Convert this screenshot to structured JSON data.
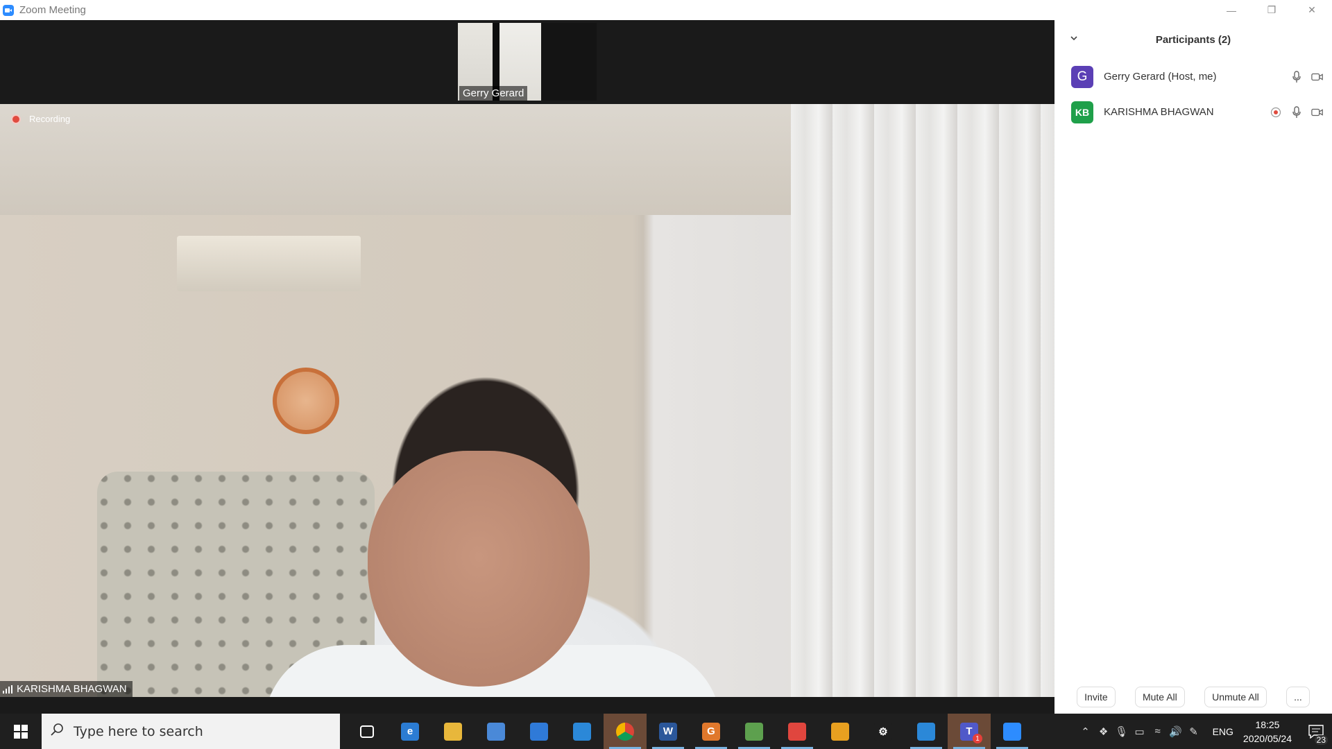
{
  "window": {
    "title": "Zoom Meeting"
  },
  "video": {
    "thumbnail_name": "Gerry Gerard",
    "recording_label": "Recording",
    "speaker_name": "KARISHMA BHAGWAN"
  },
  "participants_panel": {
    "title": "Participants (2)",
    "participants": [
      {
        "initials": "G",
        "name": "Gerry Gerard (Host, me)",
        "avatar_color": "#5b3fb5",
        "recording": false
      },
      {
        "initials": "KB",
        "name": "KARISHMA BHAGWAN",
        "avatar_color": "#1fa04a",
        "recording": true
      }
    ],
    "footer": {
      "invite": "Invite",
      "mute_all": "Mute All",
      "unmute_all": "Unmute All",
      "more": "..."
    }
  },
  "taskbar": {
    "search_placeholder": "Type here to search",
    "apps": [
      {
        "name": "task-view-icon",
        "color": "#1f1f1f",
        "label": ""
      },
      {
        "name": "edge-icon",
        "color": "#2b7cd3",
        "label": "e"
      },
      {
        "name": "file-explorer-icon",
        "color": "#e8b73b",
        "label": ""
      },
      {
        "name": "store-icon",
        "color": "#4a89d8",
        "label": ""
      },
      {
        "name": "mail-icon",
        "color": "#2f7ad8",
        "label": ""
      },
      {
        "name": "calculator-icon",
        "color": "#2b88d8",
        "label": ""
      },
      {
        "name": "chrome-icon",
        "color": "#e3a93a",
        "label": ""
      },
      {
        "name": "word-icon",
        "color": "#2b579a",
        "label": "W"
      },
      {
        "name": "grammarly-icon",
        "color": "#e0782c",
        "label": "G"
      },
      {
        "name": "maps-icon",
        "color": "#5da04e",
        "label": ""
      },
      {
        "name": "snip-icon",
        "color": "#e0463e",
        "label": ""
      },
      {
        "name": "vpn-icon",
        "color": "#e8a020",
        "label": ""
      },
      {
        "name": "settings-icon",
        "color": "#1f1f1f",
        "label": "⚙"
      },
      {
        "name": "photos-icon",
        "color": "#2b88d8",
        "label": ""
      },
      {
        "name": "teams-icon",
        "color": "#5059c9",
        "label": "T"
      },
      {
        "name": "zoom-icon",
        "color": "#2d8cff",
        "label": ""
      }
    ],
    "teams_badge": "1",
    "language": "ENG",
    "time": "18:25",
    "date": "2020/05/24",
    "notification_count": "23"
  }
}
